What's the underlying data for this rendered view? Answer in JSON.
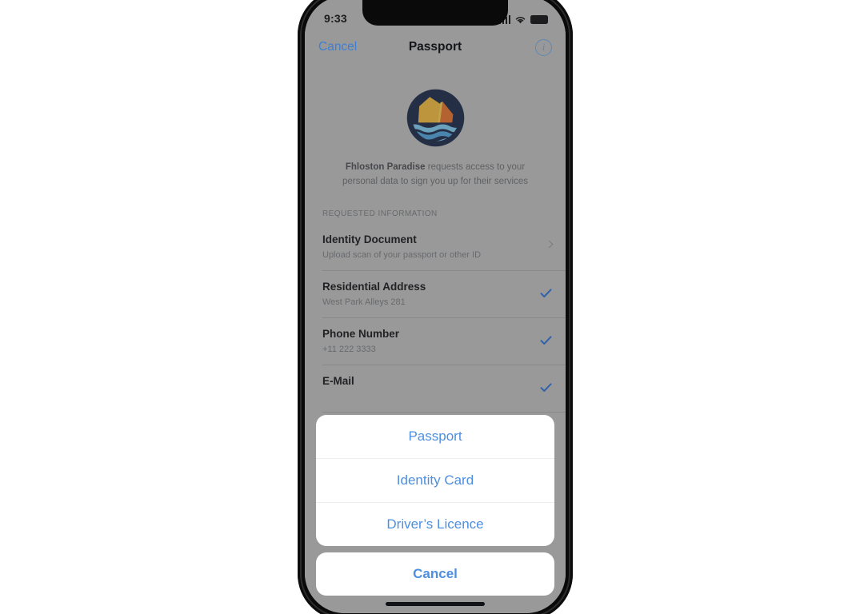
{
  "status_bar": {
    "time": "9:33",
    "icons": [
      "signal-bars-icon",
      "wifi-icon",
      "battery-icon"
    ]
  },
  "nav_bar": {
    "cancel_label": "Cancel",
    "title": "Passport",
    "info_glyph": "i"
  },
  "app": {
    "logo_name": "fhloston-paradise-logo",
    "logo_colors": {
      "ring": "#1b2a4a",
      "sun": "#e8b43c",
      "sail": "#e2762f",
      "sea_light": "#7cc4e8",
      "sea_dark": "#2f6fae"
    },
    "consent_org": "Fhloston Paradise",
    "consent_rest": " requests access to your personal data to sign you up for their services"
  },
  "section": {
    "header": "REQUESTED INFORMATION",
    "rows": [
      {
        "title": "Identity Document",
        "subtitle": "Upload scan of your passport or other ID",
        "accessory": "chevron-right-icon"
      },
      {
        "title": "Residential Address",
        "subtitle": "West Park Alleys 281",
        "accessory": "checkmark-icon"
      },
      {
        "title": "Phone Number",
        "subtitle": "+11 222 3333",
        "accessory": "checkmark-icon"
      },
      {
        "title": "E-Mail",
        "subtitle": "",
        "accessory": "checkmark-icon"
      }
    ]
  },
  "action_sheet": {
    "options": [
      "Passport",
      "Identity Card",
      "Driver’s Licence"
    ],
    "cancel_label": "Cancel"
  },
  "colors": {
    "accent_blue": "#4d8fe0",
    "nav_blue": "#3d7fd4",
    "checkmark_blue": "#2f6fd0",
    "screen_bg": "#b9b9b9"
  }
}
